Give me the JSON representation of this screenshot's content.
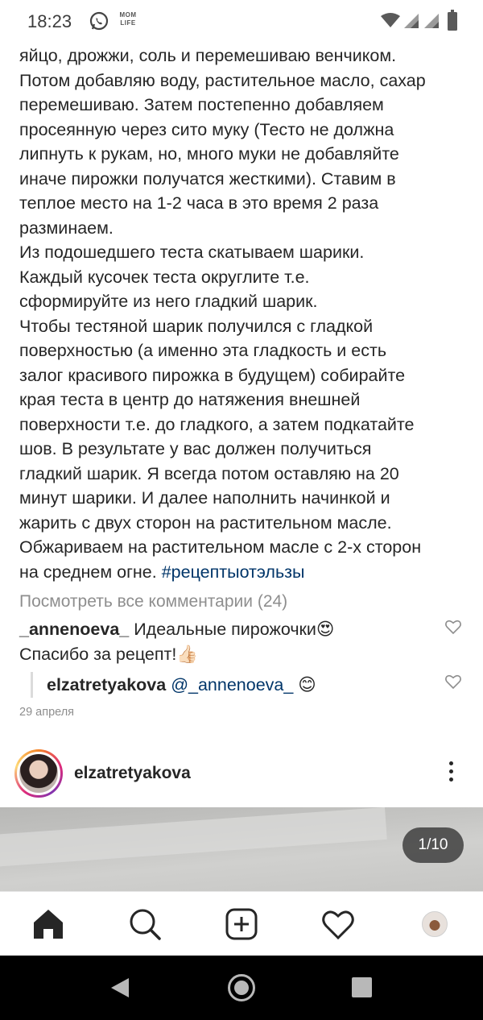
{
  "status_bar": {
    "time": "18:23",
    "mom_badge_line1": "MOM",
    "mom_badge_line2": "LIFE",
    "icons": [
      "whatsapp-icon",
      "momlife-icon",
      "wifi-icon",
      "signal-icon",
      "signal-icon",
      "battery-icon"
    ]
  },
  "caption": {
    "lines": [
      "яйцо, дрожжи, соль и перемешиваю венчиком.",
      "Потом добавляю воду, растительное масло, сахар",
      "перемешиваю. Затем постепенно добавляем",
      "просеянную через сито муку (Тесто не должна",
      "липнуть к рукам, но, много муки не добавляйте",
      "иначе пирожки получатся жесткими). Ставим в",
      "теплое место на 1-2 часа в это время 2 раза",
      "разминаем.",
      "Из подошедшего теста скатываем шарики.",
      "Каждый кусочек теста округлите т.е.",
      "сформируйте из него гладкий шарик.",
      "Чтобы тестяной шарик получился с гладкой",
      "поверхностью (а именно эта гладкость и есть",
      "залог красивого пирожка в будущем) собирайте",
      "края теста в центр до натяжения внешней",
      "поверхности т.е. до гладкого, а затем подкатайте",
      "шов. В результате у вас должен получиться",
      "гладкий шарик. Я всегда потом оставляю на 20",
      "минут шарики. И далее наполнить начинкой и",
      "жарить с двух сторон на растительном масле.",
      "Обжариваем на растительном масле с 2-х сторон"
    ],
    "last_line_text": "на среднем огне.",
    "hashtag": "#рецептыотэльзы"
  },
  "comments": {
    "view_all": "Посмотреть все комментарии (24)",
    "items": [
      {
        "username": "_annenoeva_",
        "text_part1": "Идеальные пирожочки",
        "emoji1": "😍",
        "text_part2": "Спасибо за рецепт!",
        "emoji2": "👍🏻"
      }
    ],
    "reply": {
      "username": "elzatretyakova",
      "mention": "@_annenoeva_",
      "emoji": "😊"
    },
    "date": "29 апреля"
  },
  "next_post": {
    "username": "elzatretyakova",
    "image_counter": "1/10"
  },
  "bottom_nav": {
    "items": [
      "home-icon",
      "search-icon",
      "add-post-icon",
      "activity-heart-icon",
      "profile-avatar"
    ]
  },
  "android_nav": {
    "items": [
      "back-icon",
      "home-circle-icon",
      "recents-icon"
    ]
  }
}
